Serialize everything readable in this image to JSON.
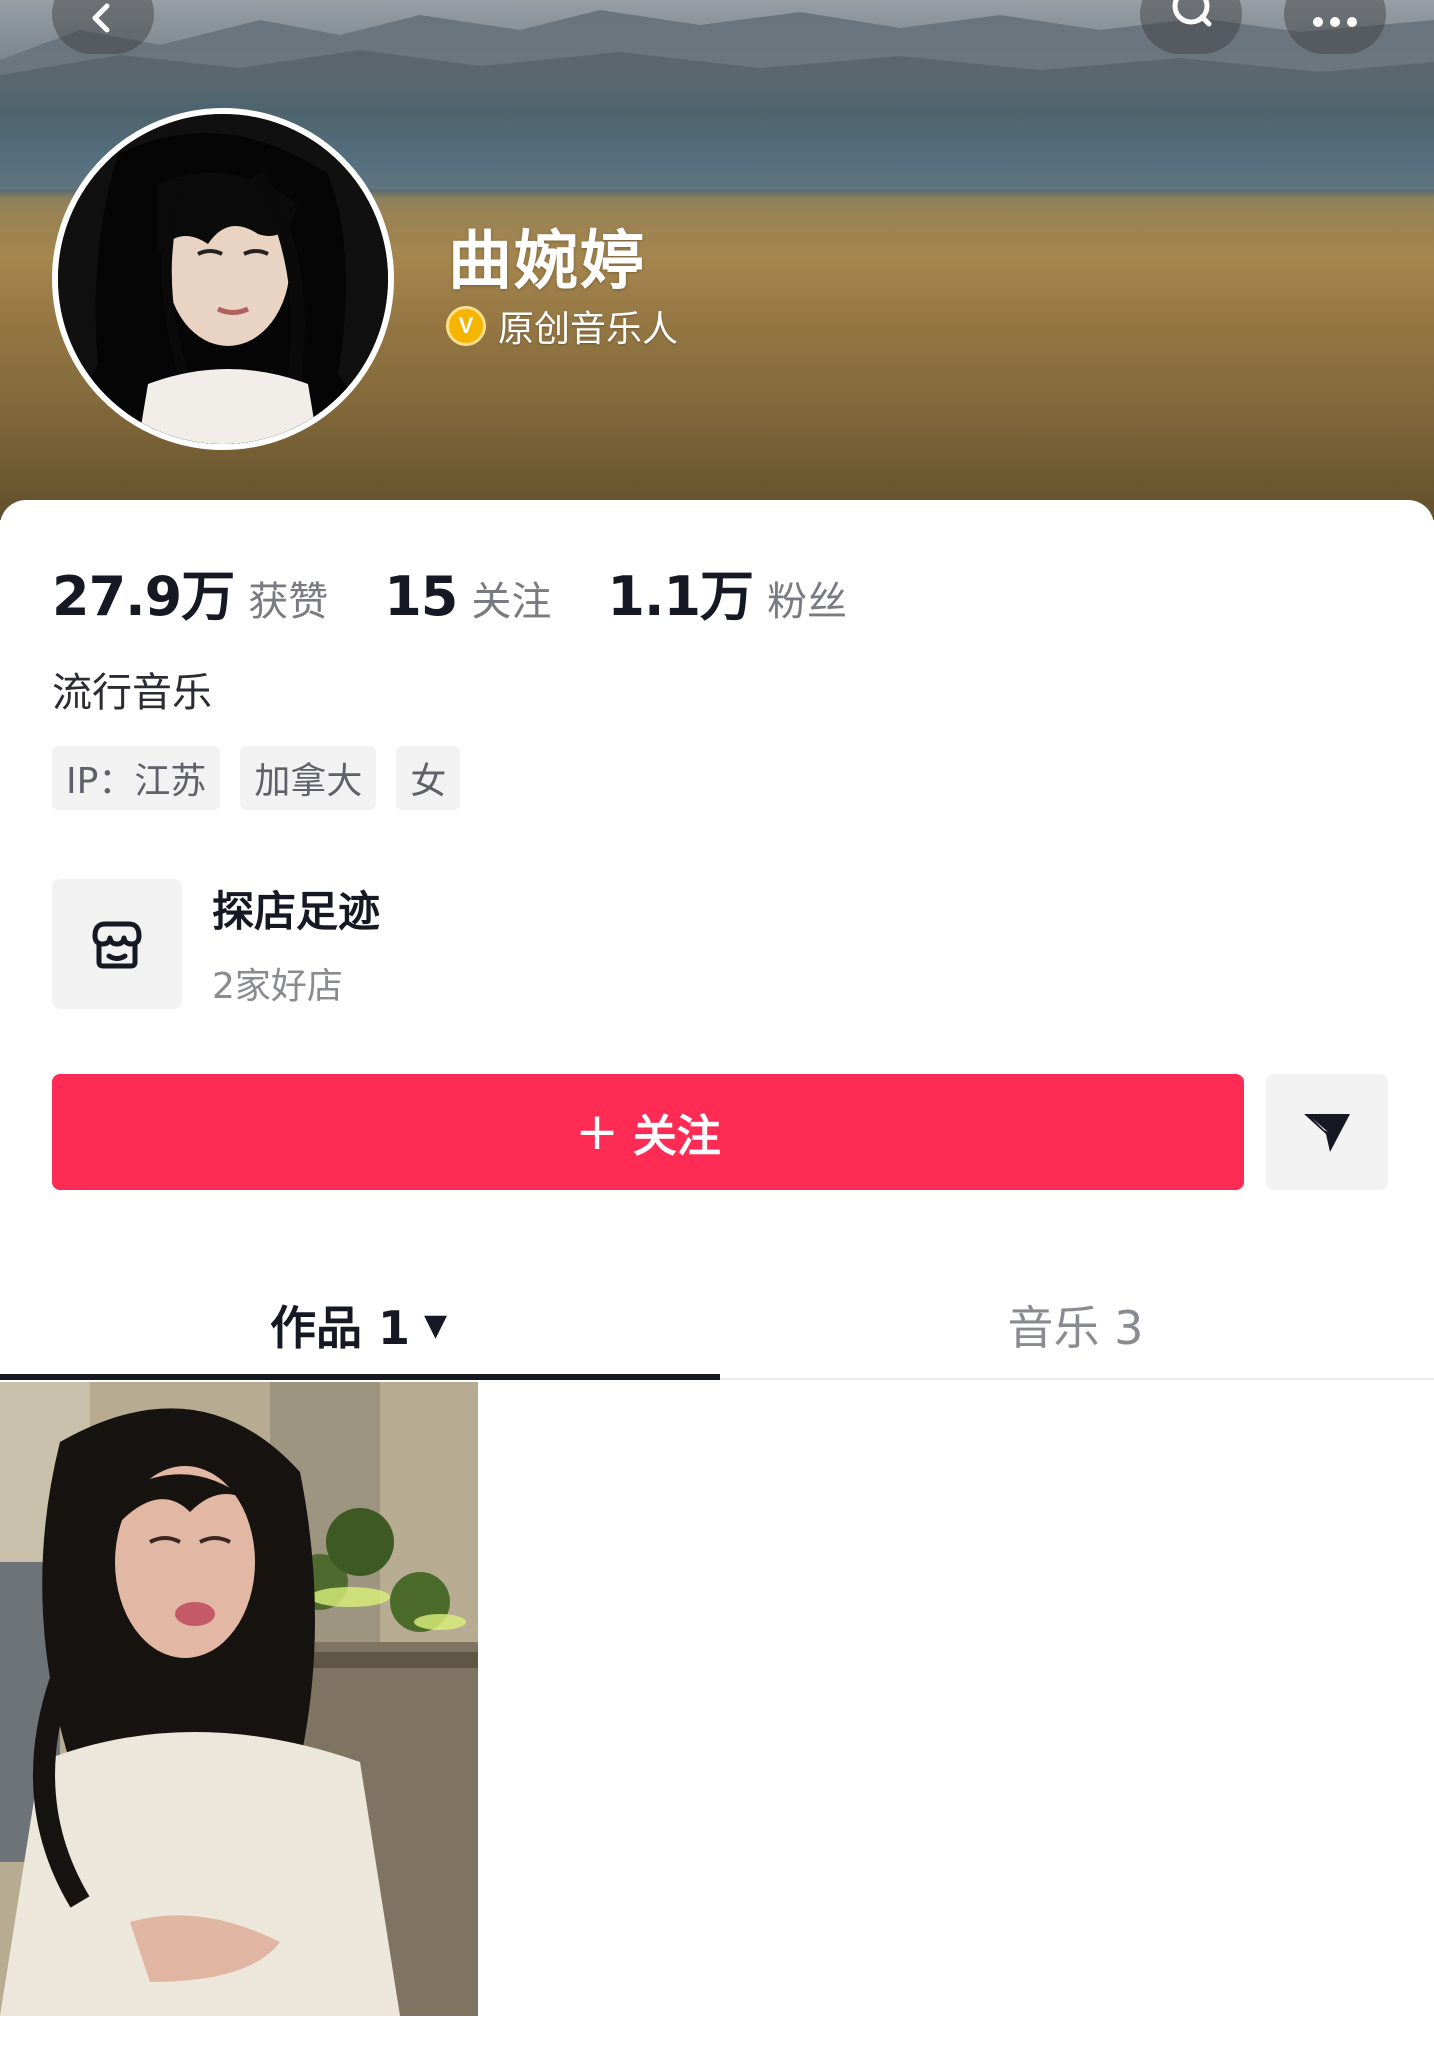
{
  "header": {
    "back_icon": "chevron-left-icon",
    "search_icon": "search-icon",
    "more_icon": "more-dots-icon"
  },
  "profile": {
    "name": "曲婉婷",
    "verify_badge": "V",
    "verify_text": "原创音乐人",
    "verify_color": "#f5b400"
  },
  "stats": [
    {
      "value": "27.9万",
      "label": "获赞"
    },
    {
      "value": "15",
      "label": "关注"
    },
    {
      "value": "1.1万",
      "label": "粉丝"
    }
  ],
  "bio": "流行音乐",
  "tags": [
    "IP：江苏",
    "加拿大",
    "女"
  ],
  "store": {
    "title": "探店足迹",
    "subtitle": "2家好店",
    "icon": "store-icon"
  },
  "actions": {
    "follow_plus": "+",
    "follow_label": "关注",
    "follow_color": "#fe2c55",
    "share_icon": "send-icon"
  },
  "tabs": {
    "works_label": "作品 1",
    "works_caret": "▼",
    "music_label": "音乐 3"
  }
}
